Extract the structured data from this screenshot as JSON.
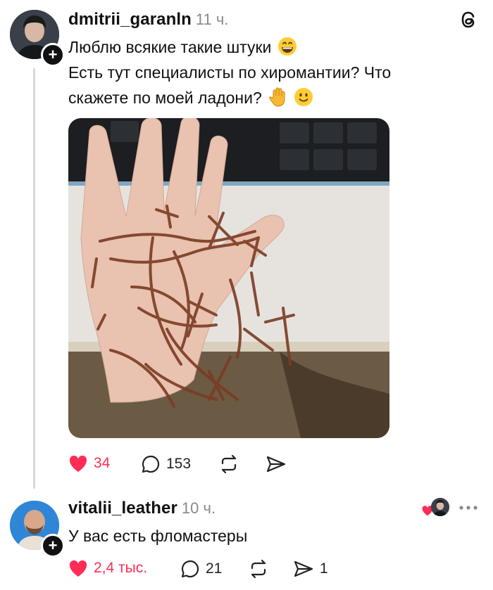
{
  "post": {
    "username": "dmitrii_garanln",
    "time": "11 ч.",
    "line1": "Люблю всякие такие штуки",
    "line2": "Есть тут специалисты по хиромантии? Что",
    "line3": "скажете по моей ладони?",
    "likes": "34",
    "comments": "153"
  },
  "reply": {
    "username": "vitalii_leather",
    "time": "10 ч.",
    "text": "У вас есть фломастеры",
    "likes": "2,4 тыс.",
    "comments": "21",
    "shares": "1"
  },
  "icons": {
    "app_logo": "threads-logo-icon",
    "like": "heart-icon",
    "comment": "comment-bubble-icon",
    "repost": "repost-icon",
    "share": "send-icon",
    "more": "more-dots-icon"
  },
  "colors": {
    "accent_like": "#ff2d55",
    "thread_line": "#d9d9d9",
    "muted_text": "#8a8a8a"
  }
}
